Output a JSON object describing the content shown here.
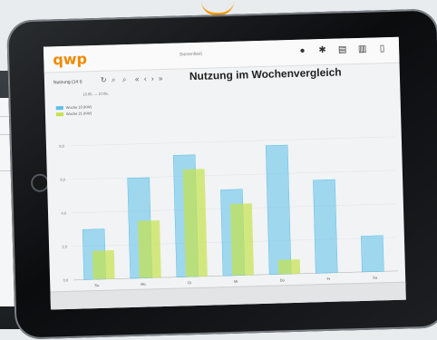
{
  "app": {
    "logo": "qwp",
    "brand": "Bienenfleiß",
    "title": "Nutzung im Wochenvergleich"
  },
  "toolbar": {
    "week_select": "Nutzung (14 t)",
    "date_range": "13.05. ↔ 27.05."
  },
  "icons": [
    "gear-icon",
    "settings-icon",
    "grid-icon",
    "chart-icon",
    "file-icon"
  ],
  "colors": {
    "week1": "#5bc0eb",
    "week2": "#c5e24d",
    "accent": "#f08a00"
  },
  "chart_data": {
    "type": "bar",
    "categories": [
      "So",
      "Mo",
      "Di",
      "Mi",
      "Do",
      "Fr",
      "Sa"
    ],
    "series": [
      {
        "name": "Woche 19 (KW)",
        "values": [
          7,
          14,
          17,
          12,
          18,
          13,
          5
        ]
      },
      {
        "name": "Woche 21 (KW)",
        "values": [
          4,
          8,
          15,
          10,
          2,
          null,
          null
        ]
      }
    ],
    "yticks": [
      "0,0",
      "2,0",
      "4,0",
      "6,0",
      "8,0"
    ],
    "ylim": [
      0,
      20
    ]
  }
}
